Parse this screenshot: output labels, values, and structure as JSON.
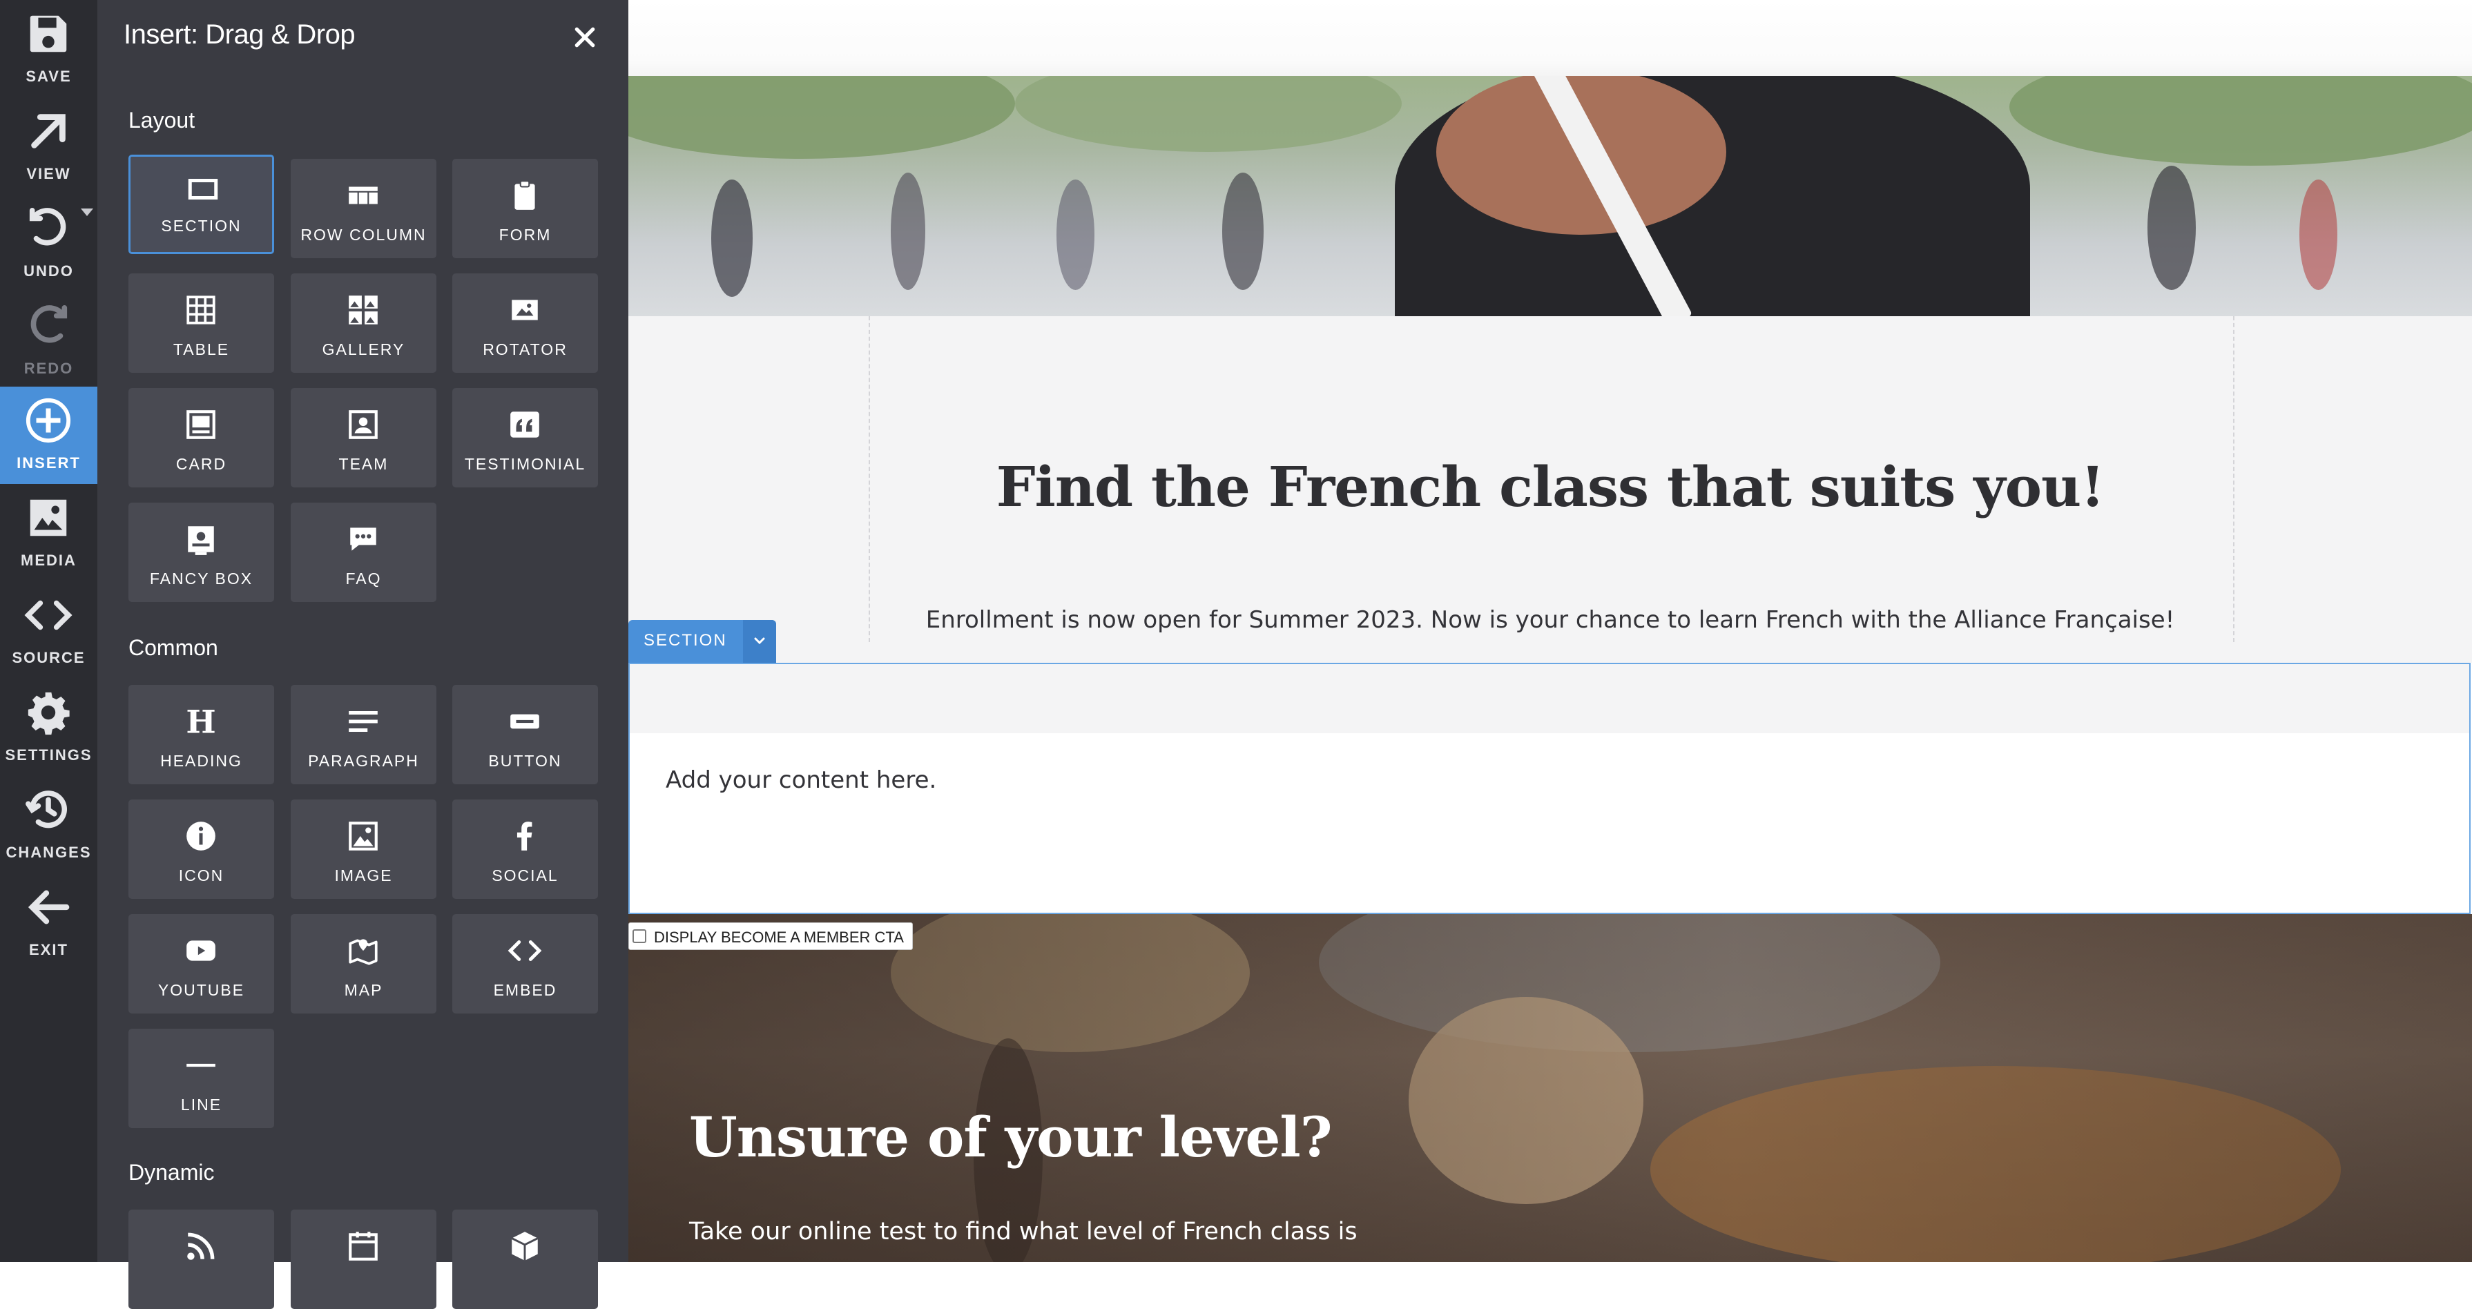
{
  "toolbar": {
    "items": [
      {
        "label": "SAVE",
        "icon": "floppy-disk-icon"
      },
      {
        "label": "VIEW",
        "icon": "arrow-up-right-icon"
      },
      {
        "label": "UNDO",
        "icon": "undo-icon"
      },
      {
        "label": "REDO",
        "icon": "redo-icon"
      },
      {
        "label": "INSERT",
        "icon": "plus-circle-icon"
      },
      {
        "label": "MEDIA",
        "icon": "image-icon"
      },
      {
        "label": "SOURCE",
        "icon": "code-icon"
      },
      {
        "label": "SETTINGS",
        "icon": "gear-icon"
      },
      {
        "label": "CHANGES",
        "icon": "history-icon"
      },
      {
        "label": "EXIT",
        "icon": "arrow-left-icon"
      }
    ],
    "active": "INSERT",
    "disabled": [
      "REDO"
    ]
  },
  "panel": {
    "title": "Insert: Drag & Drop",
    "categories": {
      "layout": "Layout",
      "common": "Common",
      "dynamic": "Dynamic"
    },
    "layout_items": [
      {
        "label": "SECTION",
        "icon": "section-icon",
        "selected": true
      },
      {
        "label": "ROW COLUMN",
        "icon": "row-column-icon"
      },
      {
        "label": "FORM",
        "icon": "clipboard-icon"
      },
      {
        "label": "TABLE",
        "icon": "table-icon"
      },
      {
        "label": "GALLERY",
        "icon": "gallery-icon"
      },
      {
        "label": "ROTATOR",
        "icon": "rotator-icon"
      },
      {
        "label": "CARD",
        "icon": "card-icon"
      },
      {
        "label": "TEAM",
        "icon": "team-icon"
      },
      {
        "label": "TESTIMONIAL",
        "icon": "quote-icon"
      },
      {
        "label": "FANCY BOX",
        "icon": "fancy-box-icon"
      },
      {
        "label": "FAQ",
        "icon": "chat-bubble-icon"
      }
    ],
    "common_items": [
      {
        "label": "HEADING",
        "icon": "heading-icon"
      },
      {
        "label": "PARAGRAPH",
        "icon": "paragraph-icon"
      },
      {
        "label": "BUTTON",
        "icon": "button-icon"
      },
      {
        "label": "ICON",
        "icon": "info-circle-icon"
      },
      {
        "label": "IMAGE",
        "icon": "image-icon"
      },
      {
        "label": "SOCIAL",
        "icon": "facebook-icon"
      },
      {
        "label": "YOUTUBE",
        "icon": "youtube-icon"
      },
      {
        "label": "MAP",
        "icon": "map-icon"
      },
      {
        "label": "EMBED",
        "icon": "code-icon"
      },
      {
        "label": "LINE",
        "icon": "line-icon"
      }
    ],
    "dynamic_items": [
      {
        "icon": "rss-icon"
      },
      {
        "icon": "calendar-icon"
      },
      {
        "icon": "cube-icon"
      }
    ]
  },
  "canvas": {
    "intro_heading": "Find the French class that suits you!",
    "intro_text": "Enrollment is now open for Summer 2023. Now is your chance to learn French with the Alliance Française!",
    "section_tag": "SECTION",
    "section_placeholder": "Add your content here.",
    "member_cta_label": "DISPLAY BECOME A MEMBER CTA",
    "member_cta_checked": false,
    "level_heading": "Unsure of your level?",
    "level_text": "Take our online test to find what level of French class is"
  },
  "colors": {
    "toolbar_bg": "#2b2c31",
    "panel_bg": "#3a3b42",
    "tile_bg": "#494a52",
    "accent": "#4a90d9"
  }
}
